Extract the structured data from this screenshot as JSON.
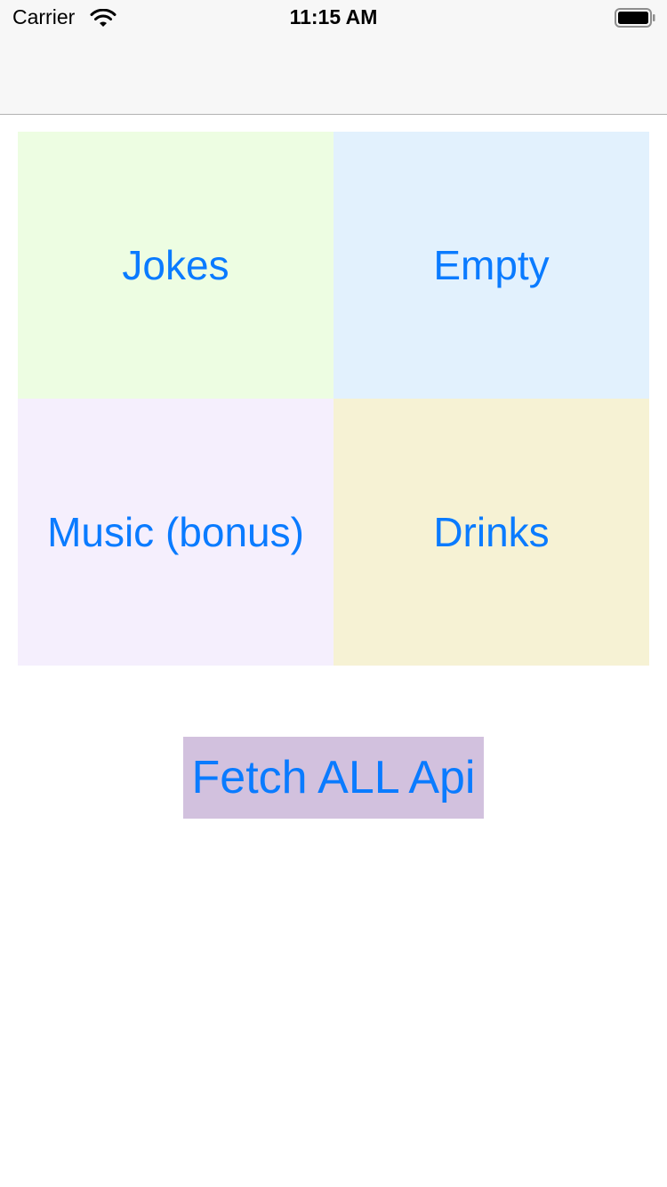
{
  "status_bar": {
    "carrier": "Carrier",
    "time": "11:15 AM",
    "wifi_icon": "wifi-icon",
    "battery_icon": "battery-icon"
  },
  "nav_bar": {
    "title": ""
  },
  "grid": {
    "tiles": [
      {
        "label": "Jokes",
        "color": "#edfde2"
      },
      {
        "label": "Empty",
        "color": "#e2f1fd"
      },
      {
        "label": "Music (bonus)",
        "color": "#f5effd"
      },
      {
        "label": "Drinks",
        "color": "#f6f2d4"
      }
    ]
  },
  "fetch_button": {
    "label": "Fetch ALL Api",
    "color": "#d2c1de"
  },
  "colors": {
    "accent": "#0a7bff",
    "bar_background": "#f7f7f7"
  }
}
